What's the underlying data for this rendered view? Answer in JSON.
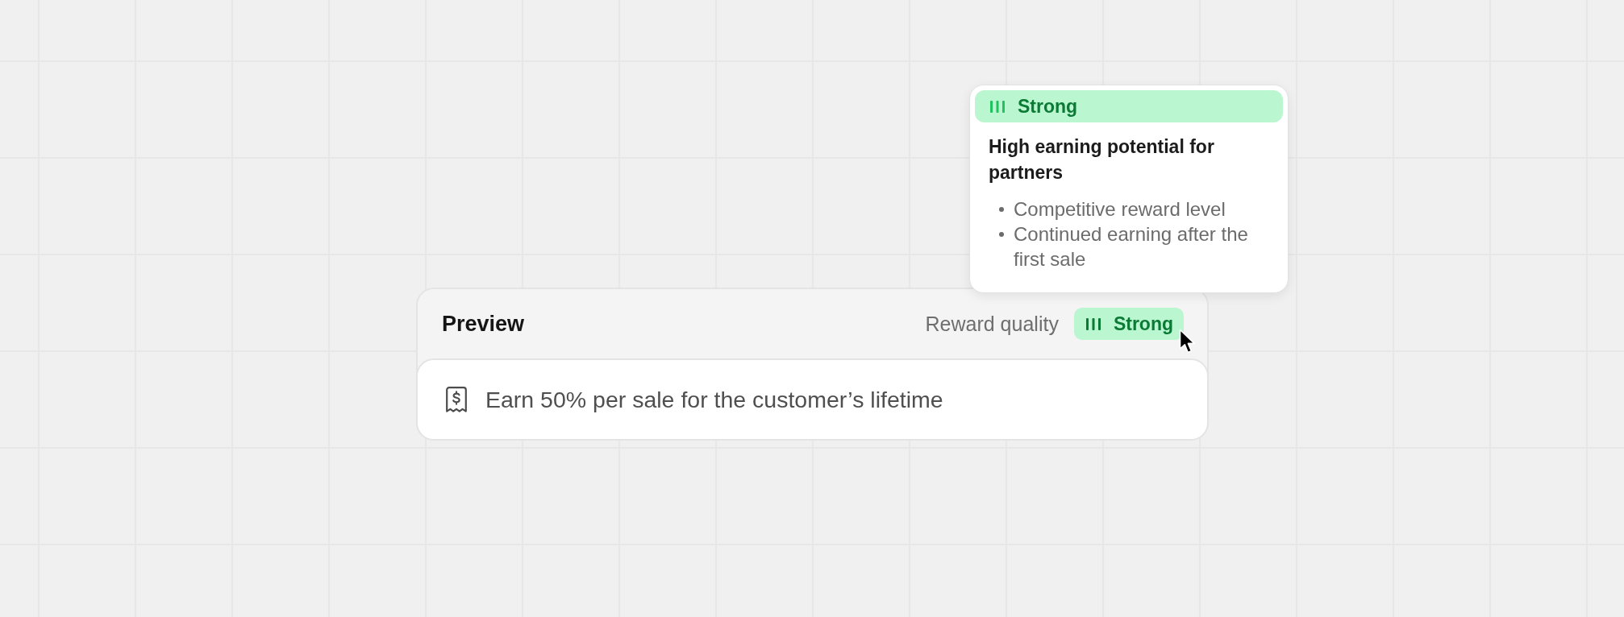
{
  "preview_card": {
    "title": "Preview",
    "quality_label": "Reward quality",
    "quality_badge": "Strong",
    "message": "Earn 50% per sale for the customer’s lifetime"
  },
  "tooltip": {
    "badge": "Strong",
    "heading": "High earning potential for partners",
    "points": [
      "Competitive reward level",
      "Continued earning after the first sale"
    ]
  }
}
